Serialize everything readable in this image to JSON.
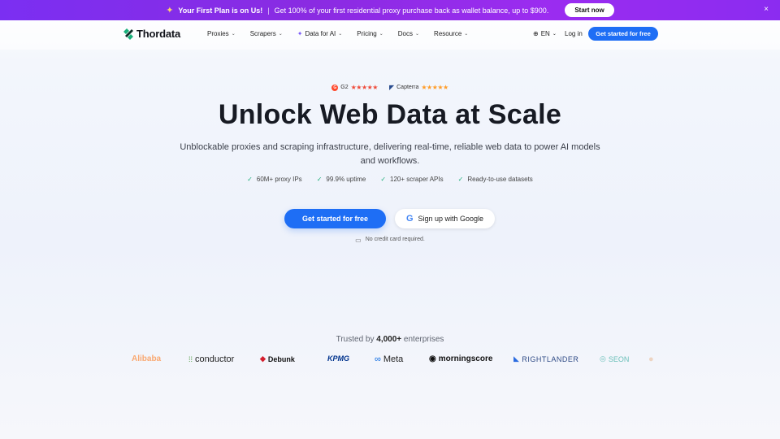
{
  "promo": {
    "icon": "party-popper-icon",
    "title": "Your First Plan is on Us!",
    "separator": "|",
    "text": "Get 100% of your first residential proxy purchase back as wallet balance, up to $900.",
    "button": "Start now",
    "close": "×"
  },
  "nav": {
    "brand": "Thordata",
    "menu": [
      "Proxies",
      "Scrapers",
      "Data for AI",
      "Pricing",
      "Docs",
      "Resource"
    ],
    "lang": "EN",
    "login": "Log in",
    "cta": "Get started for free"
  },
  "ratings": {
    "g2_label": "G2",
    "g2_stars": "★★★★★",
    "capterra_label": "Capterra",
    "capterra_stars": "★★★★★"
  },
  "hero": {
    "title": "Unlock Web Data at Scale",
    "subtitle": "Unblockable proxies and scraping infrastructure, delivering real-time, reliable web data to power AI models and workflows.",
    "features": [
      "60M+ proxy IPs",
      "99.9% uptime",
      "120+ scraper APIs",
      "Ready-to-use datasets"
    ],
    "cta_primary": "Get started for free",
    "cta_google": "Sign up with Google",
    "no_card": "No credit card required."
  },
  "trusted": {
    "prefix": "Trusted by",
    "count": "4,000+",
    "suffix": "enterprises",
    "logos": [
      "Alibaba",
      "conductor",
      "Debunk",
      "KPMG",
      "Meta",
      "morningscore",
      "RIGHTLANDER",
      "SEON"
    ]
  },
  "colors": {
    "accent": "#1e6ef5",
    "promo": "#8a2be2"
  }
}
